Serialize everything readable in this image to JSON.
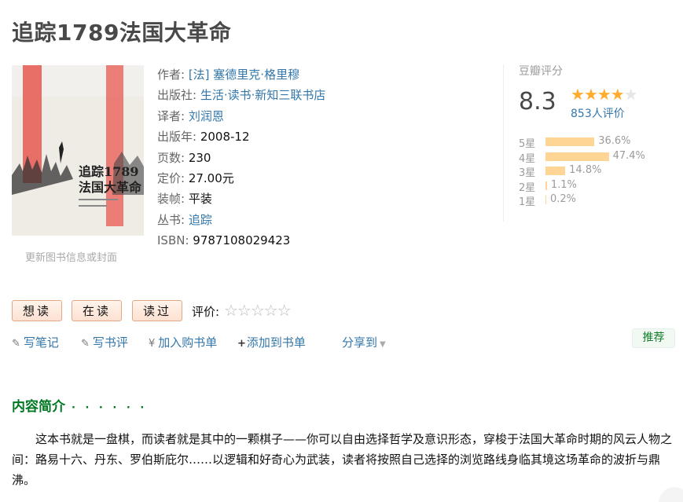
{
  "book": {
    "title": "追踪1789法国大革命",
    "cover": {
      "title_line1": "追踪1789",
      "title_line2": "法国大革命"
    },
    "update_cover_link": "更新图书信息或封面",
    "info": [
      {
        "key": "作者:",
        "value": "[法] 塞德里克·格里穆",
        "link": true
      },
      {
        "key": "出版社:",
        "value": "生活·读书·新知三联书店",
        "link": true
      },
      {
        "key": "译者:",
        "value": "刘润恩",
        "link": true
      },
      {
        "key": "出版年:",
        "value": "2008-12",
        "link": false
      },
      {
        "key": "页数:",
        "value": "230",
        "link": false
      },
      {
        "key": "定价:",
        "value": "27.00元",
        "link": false
      },
      {
        "key": "装帧:",
        "value": "平装",
        "link": false
      },
      {
        "key": "丛书:",
        "value": "追踪",
        "link": true
      },
      {
        "key": "ISBN:",
        "value": "9787108029423",
        "link": false
      }
    ]
  },
  "rating": {
    "label": "豆瓣评分",
    "score": "8.3",
    "stars_filled": 4,
    "stars_total": 5,
    "count_text": "853人评价",
    "breakdown": [
      {
        "label": "5星",
        "percent": 36.6,
        "text": "36.6%"
      },
      {
        "label": "4星",
        "percent": 47.4,
        "text": "47.4%"
      },
      {
        "label": "3星",
        "percent": 14.8,
        "text": "14.8%"
      },
      {
        "label": "2星",
        "percent": 1.1,
        "text": "1.1%"
      },
      {
        "label": "1星",
        "percent": 0.2,
        "text": "0.2%"
      }
    ]
  },
  "buttons": {
    "want": "想读",
    "reading": "在读",
    "read": "读过",
    "rate_label": "评价:"
  },
  "actions": {
    "write_note": "写笔记",
    "write_review": "写书评",
    "add_cart": "加入购书单",
    "add_list": "添加到书单",
    "share": "分享到",
    "recommend": "推荐"
  },
  "intro": {
    "heading": "内容简介",
    "dots": "· · · · · ·",
    "text": "这本书就是一盘棋，而读者就是其中的一颗棋子——你可以自由选择哲学及意识形态，穿梭于法国大革命时期的风云人物之间：路易十六、丹东、罗伯斯庇尔……以逻辑和好奇心为武装，读者将按照自己选择的浏览路线身临其境这场革命的波折与鼎沸。"
  },
  "colors": {
    "link": "#3377aa",
    "star": "#ffac2d",
    "bar": "#ffd596",
    "heading_green": "#007722"
  }
}
